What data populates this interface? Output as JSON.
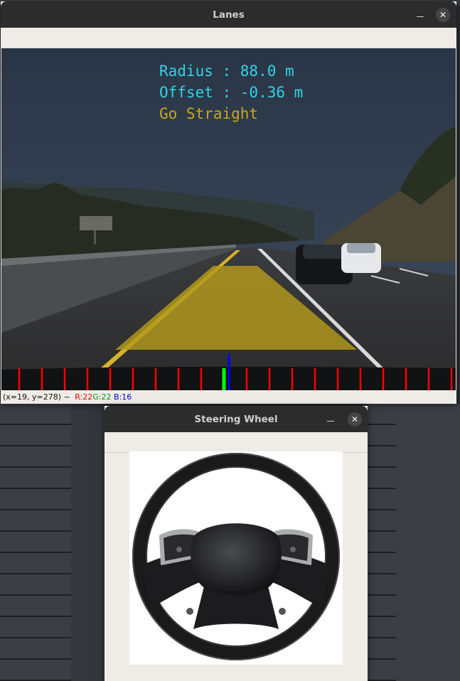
{
  "lanes_window": {
    "title": "Lanes",
    "overlay": {
      "radius": "Radius : 88.0 m",
      "offset": "Offset : -0.36 m",
      "direction": "Go Straight"
    },
    "status": {
      "coords": "(x=19, y=278) ~",
      "r": "R:22",
      "g": "G:22",
      "b": "B:16"
    }
  },
  "steering_window": {
    "title": "Steering Wheel"
  },
  "colors": {
    "overlay_text": "#2fd4e6",
    "direction_text": "#c9a81e",
    "lane_fill": "#b59a1c",
    "tick_red": "#ff0000",
    "tick_green": "#00ff00",
    "tick_blue": "#0000ff",
    "titlebar": "#2c2c2c"
  },
  "icons": {
    "minimize": "minimize-icon",
    "close": "close-icon"
  }
}
